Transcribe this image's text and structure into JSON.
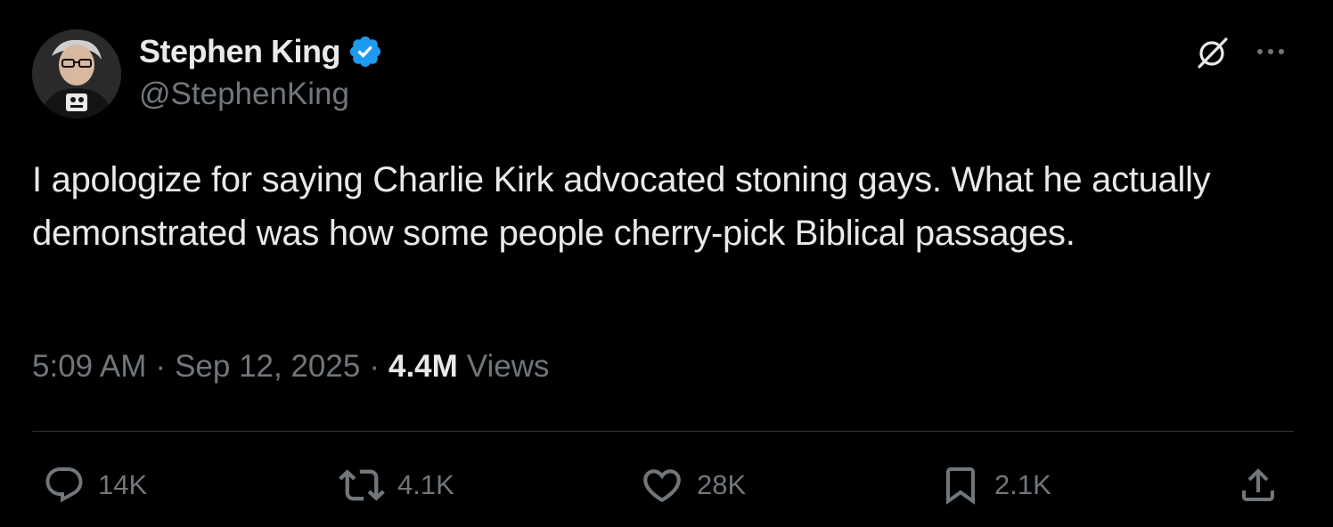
{
  "author": {
    "display_name": "Stephen King",
    "handle": "@StephenKing",
    "verified": true,
    "verified_color": "#1d9bf0"
  },
  "tweet": {
    "text": "I apologize for saying Charlie Kirk advocated stoning gays. What he actually demonstrated was how some people cherry-pick Biblical passages."
  },
  "meta": {
    "time": "5:09 AM",
    "separator": "·",
    "date": "Sep 12, 2025",
    "views_count": "4.4M",
    "views_label": "Views"
  },
  "actions": {
    "reply_count": "14K",
    "repost_count": "4.1K",
    "like_count": "28K",
    "bookmark_count": "2.1K"
  },
  "icons": {
    "header": [
      "grok-icon",
      "more-icon"
    ],
    "actions": [
      "reply-icon",
      "repost-icon",
      "like-icon",
      "bookmark-icon",
      "share-icon"
    ]
  },
  "colors": {
    "background": "#000000",
    "text_primary": "#e7e9ea",
    "text_secondary": "#71767b",
    "divider": "#2f3336"
  }
}
